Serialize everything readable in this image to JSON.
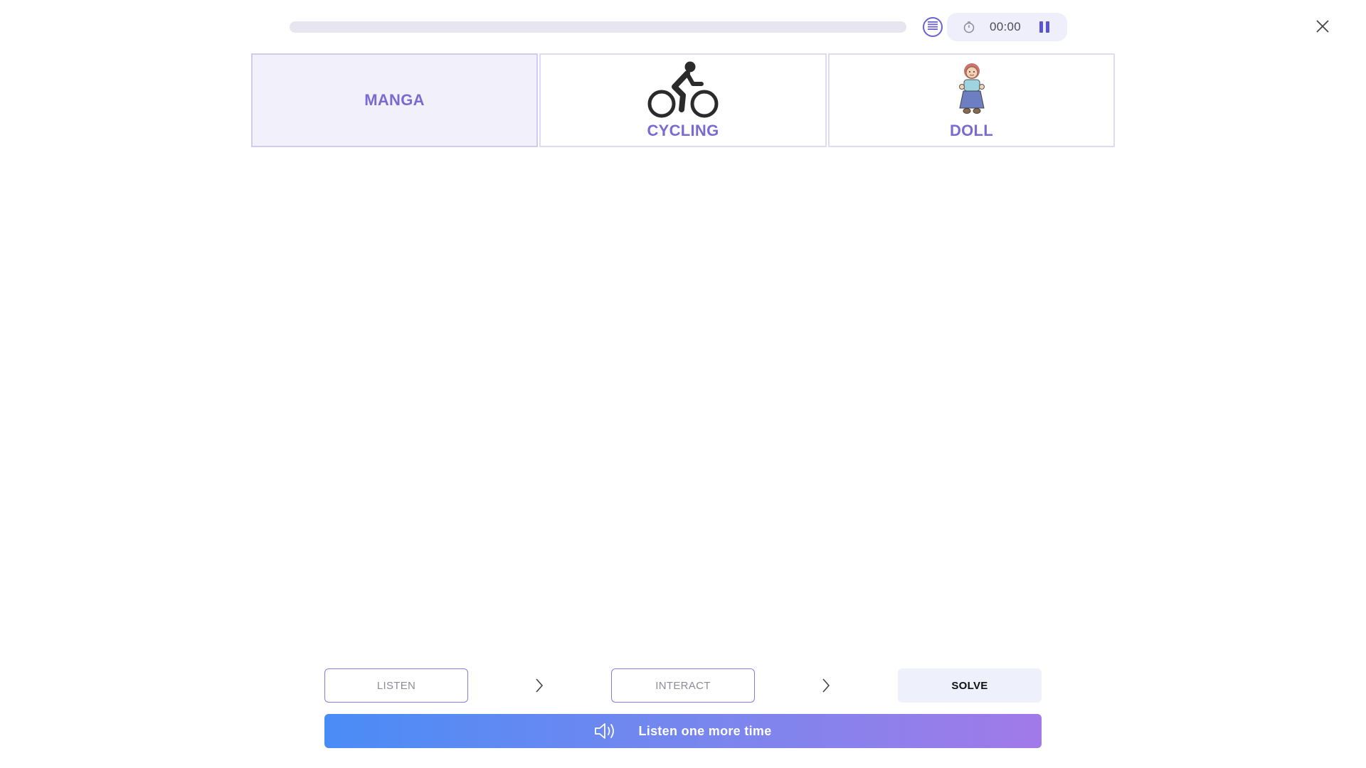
{
  "top_bar": {
    "progress": 0,
    "timer": "00:00",
    "icons": {
      "list": "list-icon",
      "clock": "clock-icon",
      "pause": "pause-icon",
      "close": "close-icon"
    }
  },
  "cards": [
    {
      "label": "MANGA",
      "icon": null,
      "selected": true
    },
    {
      "label": "CYCLING",
      "icon": "cycling-icon",
      "selected": false
    },
    {
      "label": "DOLL",
      "icon": "doll-icon",
      "selected": false
    }
  ],
  "steps": {
    "listen": "LISTEN",
    "interact": "INTERACT",
    "solve": "SOLVE",
    "active": "solve"
  },
  "listen_button": {
    "label": "Listen one more time",
    "icon": "speaker-icon"
  },
  "colors": {
    "accent": "#7a6bd0",
    "card_border": "#dddcf0",
    "selected_bg": "#f1f0fb",
    "gradient_start": "#4a8cf6",
    "gradient_end": "#a17ae8"
  }
}
